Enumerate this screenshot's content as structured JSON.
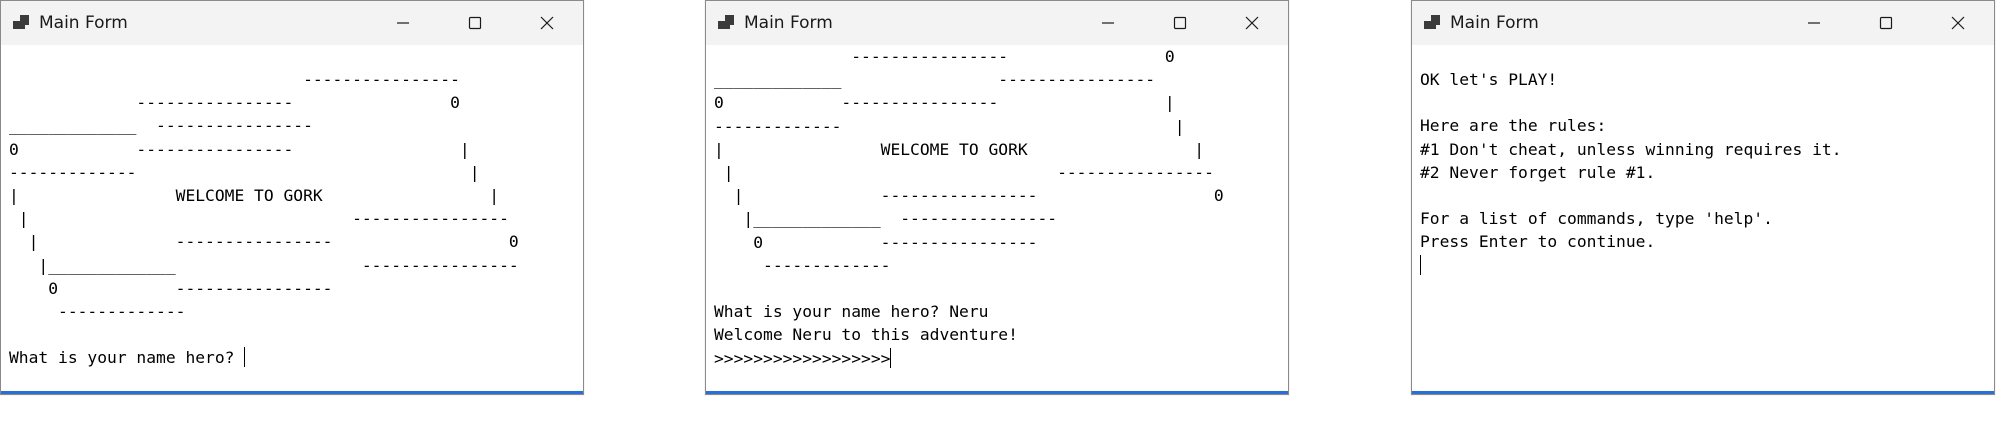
{
  "windows": [
    {
      "title": "Main Form",
      "console_text": "                              ----------------\n             ----------------                0\n_____________  ----------------\n0            ----------------                 |\n-------------                                  |\n|                WELCOME TO GORK                 |\n |                                 ----------------\n  |              ----------------                  0\n   |_____________                   ----------------\n    0            ----------------\n     -------------\n\nWhat is your name hero? "
    },
    {
      "title": "Main Form",
      "console_text": "              ----------------                0\n_____________                ----------------\n0            ----------------                 |\n-------------                                  |\n|                WELCOME TO GORK                 |\n |                                 ----------------\n  |              ----------------                  0\n   |_____________  ----------------\n    0            ----------------\n     -------------\n\nWhat is your name hero? Neru\nWelcome Neru to this adventure!\n>>>>>>>>>>>>>>>>>>"
    },
    {
      "title": "Main Form",
      "console_text": "OK let's PLAY!\n\nHere are the rules:\n#1 Don't cheat, unless winning requires it.\n#2 Never forget rule #1.\n\nFor a list of commands, type 'help'.\nPress Enter to continue.\n"
    }
  ],
  "icons": {
    "app": "app-form-icon",
    "minimize": "minimize-icon",
    "maximize": "maximize-icon",
    "close": "close-icon"
  },
  "colors": {
    "titlebar": "#f3f3f3",
    "accent": "#2a6fd6",
    "text": "#000000"
  }
}
